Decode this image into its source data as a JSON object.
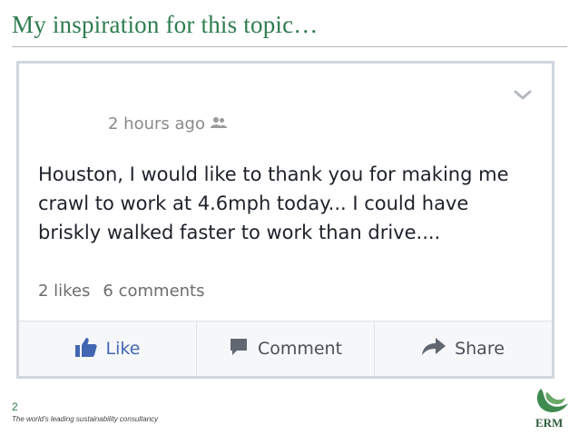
{
  "slide": {
    "title": "My inspiration for this topic…",
    "page_number": "2",
    "tagline": "The world's leading sustainability consultancy",
    "logo_text": "ERM"
  },
  "post": {
    "timestamp": "2 hours ago",
    "audience_icon": "friends-icon",
    "text_lines": [
      "Houston, I would like to thank you for making me",
      "crawl to work at 4.6mph today... I could have",
      "briskly walked faster to work than drive...."
    ],
    "likes": "2 likes",
    "comments": "6 comments"
  },
  "actions": {
    "like": "Like",
    "comment": "Comment",
    "share": "Share"
  },
  "colors": {
    "title_green": "#2e7d4f",
    "facebook_blue": "#4267b2",
    "action_gray": "#4b4f56"
  }
}
